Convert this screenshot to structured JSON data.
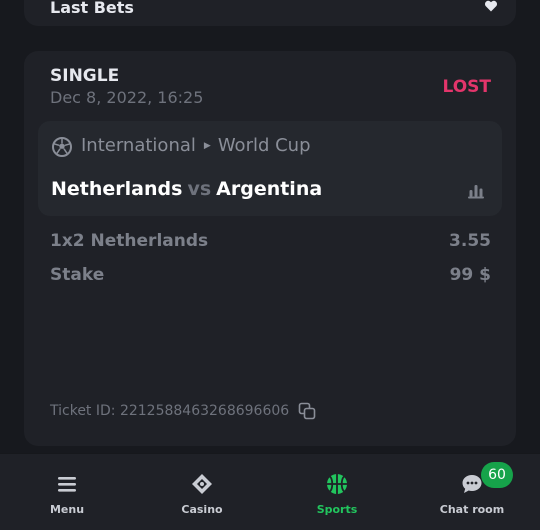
{
  "last_bets": {
    "title": "Last Bets"
  },
  "bet": {
    "type": "SINGLE",
    "date": "Dec 8, 2022, 16:25",
    "status": "LOST",
    "status_color": "#e3356b",
    "event": {
      "sport_icon": "soccer-ball-icon",
      "category": "International",
      "league": "World Cup",
      "home": "Netherlands",
      "vs": "vs",
      "away": "Argentina"
    },
    "selection_label": "1x2 Netherlands",
    "odds": "3.55",
    "stake_label": "Stake",
    "stake_value": "99 $",
    "ticket_id": "Ticket ID: 2212588463268696606"
  },
  "nav": {
    "items": [
      {
        "label": "Menu",
        "icon": "hamburger-icon"
      },
      {
        "label": "Casino",
        "icon": "casino-chip-icon"
      },
      {
        "label": "Sports",
        "icon": "sports-ball-icon",
        "active": true
      },
      {
        "label": "Chat room",
        "icon": "chat-icon",
        "badge": "60"
      }
    ],
    "accent": "#22c55e"
  }
}
